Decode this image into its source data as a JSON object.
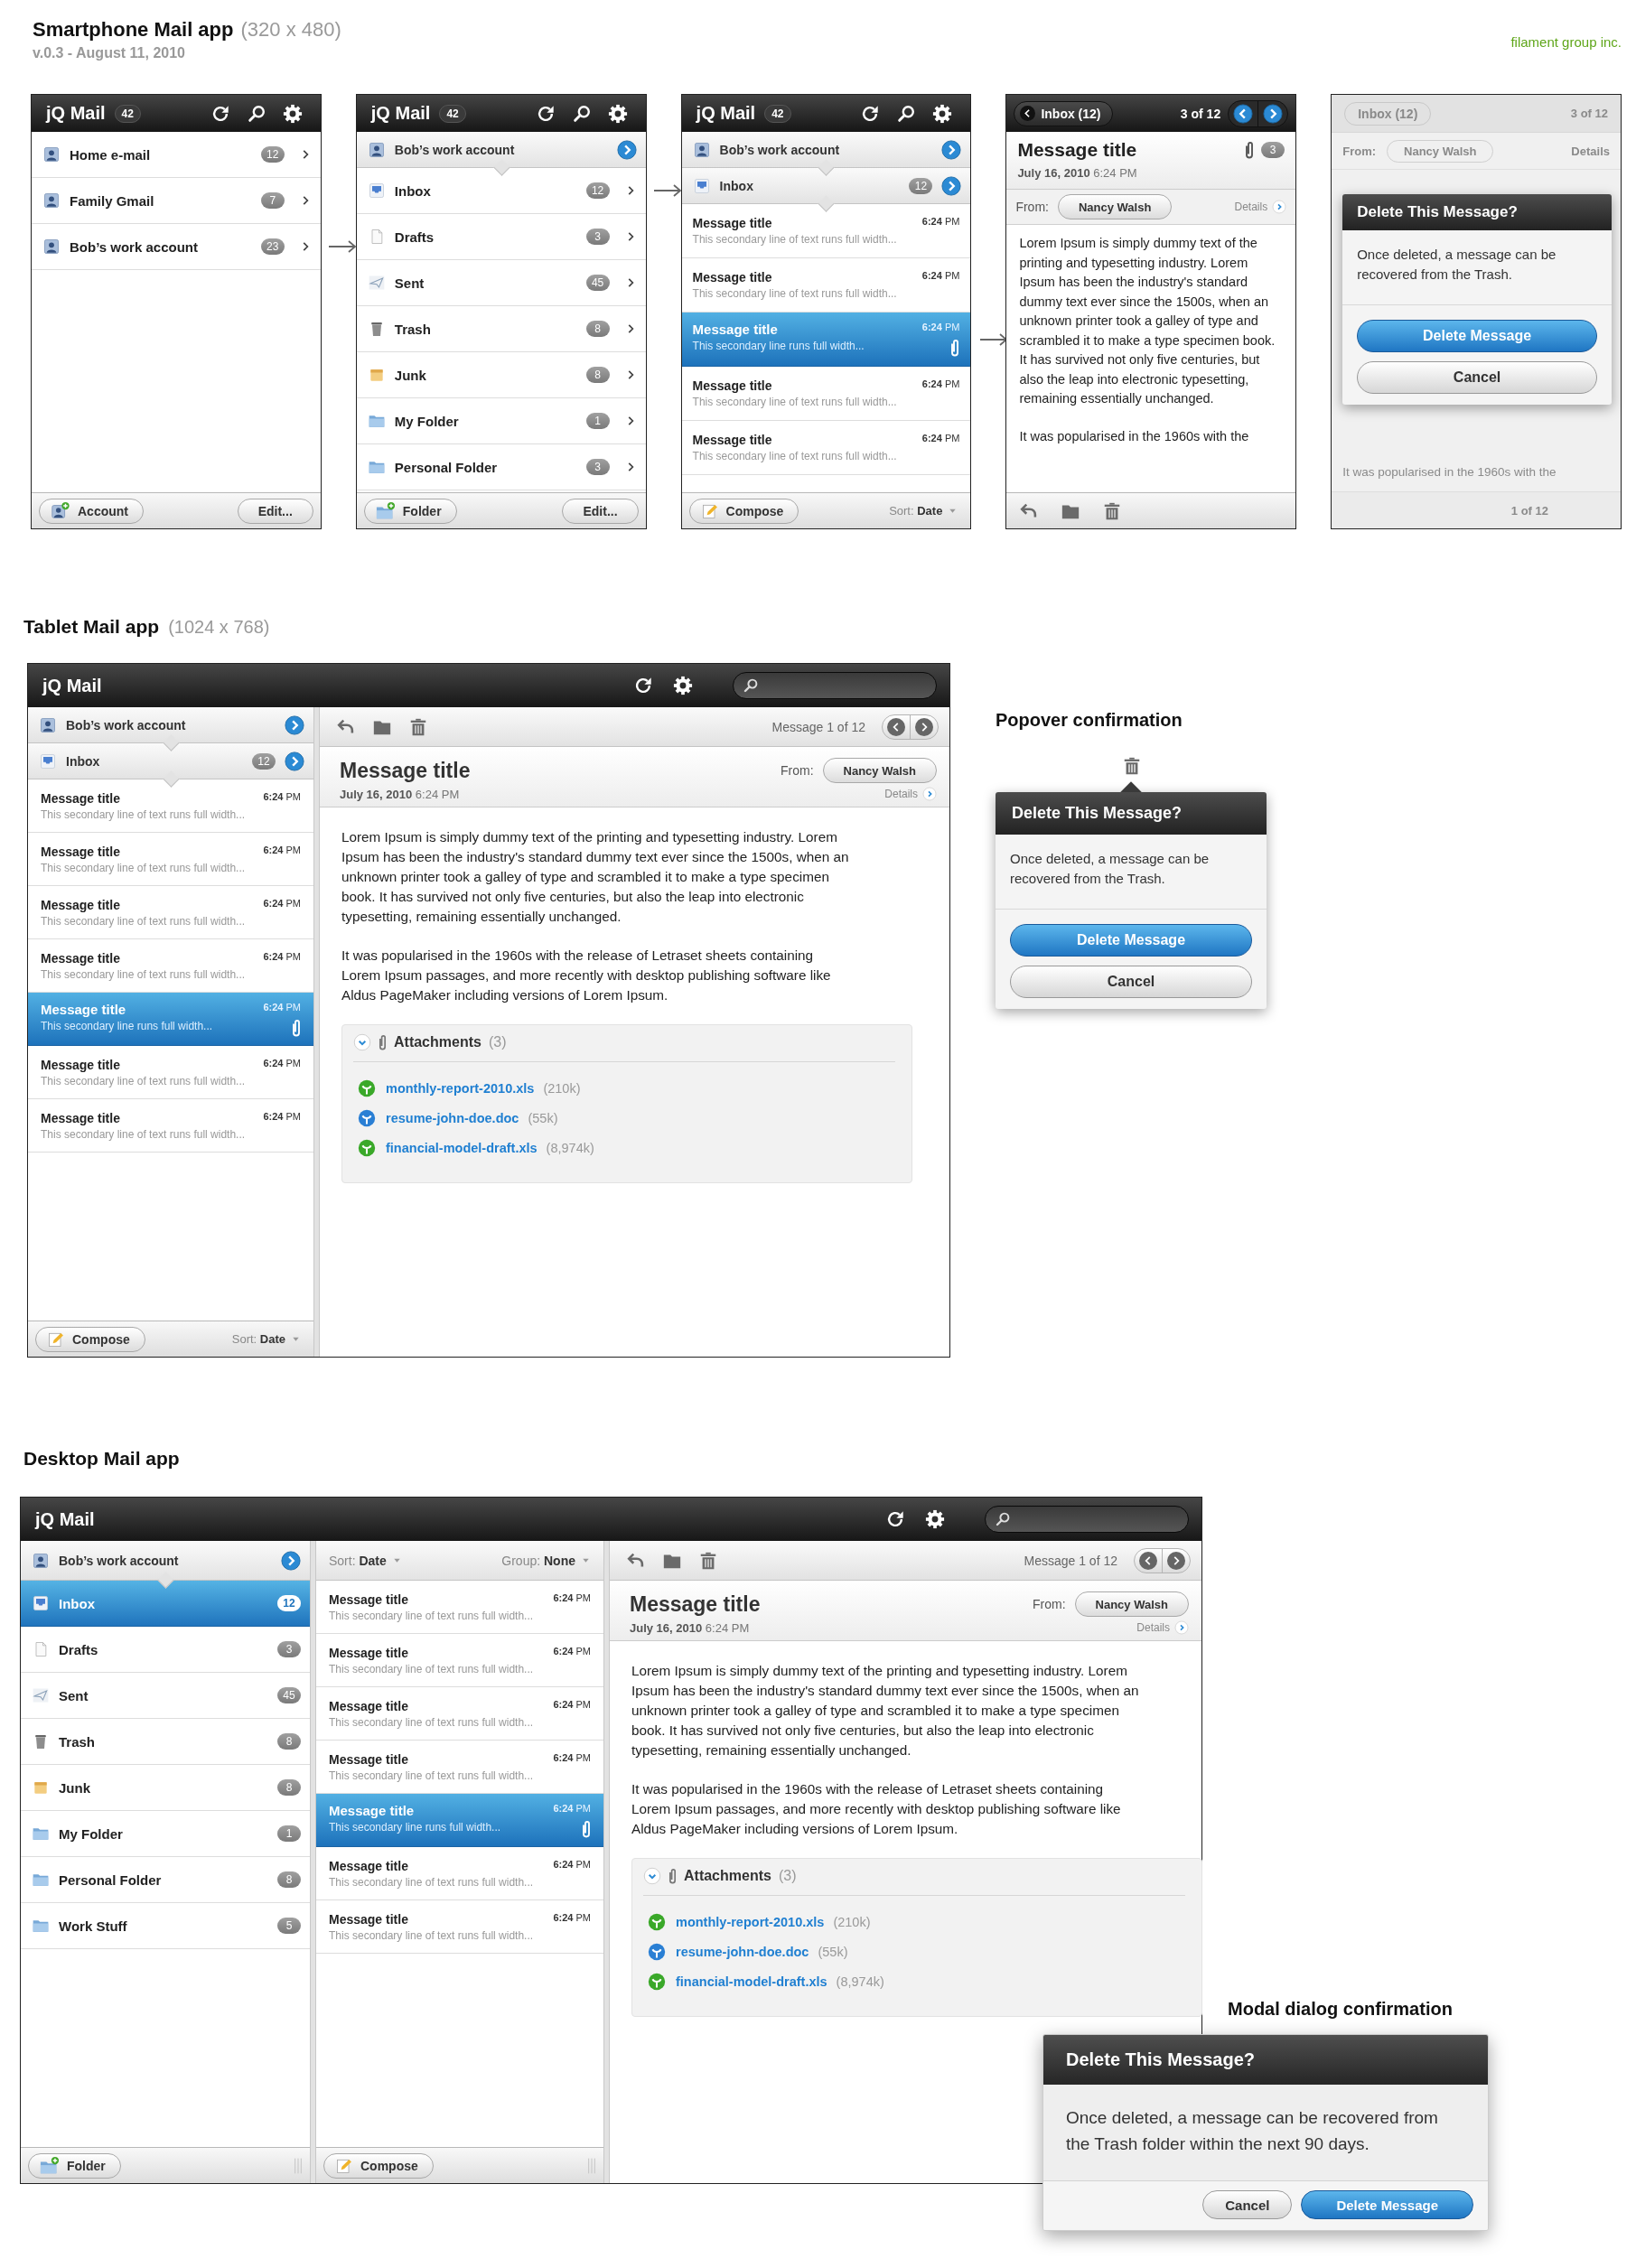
{
  "header": {
    "title": "Smartphone Mail app",
    "size": "(320 x 480)",
    "version": "v.0.3 - August 11, 2010",
    "company": "filament group inc."
  },
  "phones": [
    {
      "kind": "accounts",
      "toolbar": {
        "title": "jQ Mail",
        "count": "42"
      },
      "items": [
        {
          "kind": "account",
          "label": "Home e-mail",
          "count": "12",
          "selected": false,
          "leads_next": false
        },
        {
          "kind": "account",
          "label": "Family Gmail",
          "count": "7",
          "selected": false,
          "leads_next": false
        },
        {
          "kind": "account",
          "label": "Bob’s work account",
          "count": "23",
          "selected": false,
          "leads_next": true
        }
      ],
      "footer": {
        "add": {
          "kind": "account",
          "label": "Account"
        },
        "edit": "Edit..."
      }
    },
    {
      "kind": "folders",
      "toolbar": {
        "title": "jQ Mail",
        "count": "42"
      },
      "account": "Bob’s work account",
      "items": [
        {
          "kind": "inbox",
          "label": "Inbox",
          "count": "12",
          "selected": false,
          "leads_next": true
        },
        {
          "kind": "drafts",
          "label": "Drafts",
          "count": "3",
          "selected": false,
          "leads_next": false
        },
        {
          "kind": "sent",
          "label": "Sent",
          "count": "45",
          "selected": false,
          "leads_next": false
        },
        {
          "kind": "trash",
          "label": "Trash",
          "count": "8",
          "selected": false,
          "leads_next": false
        },
        {
          "kind": "junk",
          "label": "Junk",
          "count": "8",
          "selected": false,
          "leads_next": false
        },
        {
          "kind": "folder",
          "label": "My Folder",
          "count": "1",
          "selected": false,
          "leads_next": false
        },
        {
          "kind": "folder",
          "label": "Personal Folder",
          "count": "3",
          "selected": false,
          "leads_next": false
        }
      ],
      "footer": {
        "add": {
          "kind": "folder",
          "label": "Folder"
        },
        "edit": "Edit..."
      }
    },
    {
      "kind": "messages",
      "toolbar": {
        "title": "jQ Mail",
        "count": "42"
      },
      "account": "Bob’s work account",
      "folder": {
        "kind": "inbox",
        "label": "Inbox",
        "count": "12"
      },
      "messages": [
        {
          "title": "Message title",
          "preview": "This secondary line of text runs full width...",
          "time": "**6:24** PM",
          "selected": false,
          "attachment": false,
          "leads_next": false
        },
        {
          "title": "Message title",
          "preview": "This secondary line of text runs full width...",
          "time": "**6:24** PM",
          "selected": false,
          "attachment": false,
          "leads_next": false
        },
        {
          "title": "Message title",
          "preview": "This secondary line runs full width...",
          "time": "**6:24** PM",
          "selected": true,
          "attachment": true,
          "leads_next": true
        },
        {
          "title": "Message title",
          "preview": "This secondary line of text runs full width...",
          "time": "**6:24** PM",
          "selected": false,
          "attachment": false,
          "leads_next": false
        },
        {
          "title": "Message title",
          "preview": "This secondary line of text runs full width...",
          "time": "**6:24** PM",
          "selected": false,
          "attachment": false,
          "leads_next": false
        }
      ],
      "footer": {
        "compose": "Compose",
        "sort": "Sort: **Date**"
      }
    },
    {
      "kind": "message",
      "nav": {
        "back": "Inbox (12)",
        "position": "3 of 12"
      },
      "title": "Message title",
      "attachments": "3",
      "date": "**July 16, 2010** 6:24 PM",
      "from_label": "From:",
      "from": "Nancy Walsh",
      "details": "Details",
      "paragraphs": [
        "Lorem Ipsum is simply dummy text of the printing and typesetting industry. Lorem Ipsum has been the industry's standard dummy text ever since the 1500s, when an unknown printer took a galley of type and scrambled it to make a type specimen book. It has survived not only five centuries, but also the leap into electronic typesetting, remaining essentially unchanged.",
        "It was popularised in the 1960s with the"
      ]
    },
    {
      "kind": "dialog",
      "background": {
        "back": "Inbox (12)",
        "position": "3 of 12",
        "from_label": "From:",
        "from": "Nancy Walsh",
        "details": "Details",
        "text": "It was popularised in the 1960s with the",
        "footer_position": "1 of 12"
      },
      "dialog": {
        "title": "Delete This Message?",
        "text": "Once deleted, a message can be recovered from the Trash.",
        "confirm": "Delete Message",
        "cancel": "Cancel"
      }
    }
  ],
  "tablet": {
    "heading": "Tablet Mail app",
    "size": "(1024 x 768)",
    "title": "jQ Mail",
    "account": "Bob’s work account",
    "folder": {
      "kind": "inbox",
      "label": "Inbox",
      "count": "12"
    },
    "messages": [
      {
        "title": "Message title",
        "preview": "This secondary line of text runs full width...",
        "time": "**6:24** PM",
        "selected": false,
        "attachment": false
      },
      {
        "title": "Message title",
        "preview": "This secondary line of text runs full width...",
        "time": "**6:24** PM",
        "selected": false,
        "attachment": false
      },
      {
        "title": "Message title",
        "preview": "This secondary line of text runs full width...",
        "time": "**6:24** PM",
        "selected": false,
        "attachment": false
      },
      {
        "title": "Message title",
        "preview": "This secondary line of text runs full width...",
        "time": "**6:24** PM",
        "selected": false,
        "attachment": false
      },
      {
        "title": "Message title",
        "preview": "This secondary line runs full width...",
        "time": "**6:24** PM",
        "selected": true,
        "attachment": true
      },
      {
        "title": "Message title",
        "preview": "This secondary line of text runs full width...",
        "time": "**6:24** PM",
        "selected": false,
        "attachment": false
      },
      {
        "title": "Message title",
        "preview": "This secondary line of text runs full width...",
        "time": "**6:24** PM",
        "selected": false,
        "attachment": false
      }
    ],
    "footer": {
      "compose": "Compose",
      "sort": "Sort: **Date**"
    },
    "reader": {
      "position": "Message 1 of 12",
      "title": "Message title",
      "from_label": "From:",
      "from": "Nancy Walsh",
      "date": "**July 16, 2010** 6:24 PM",
      "details": "Details",
      "paragraphs": [
        "Lorem Ipsum is simply dummy text of the printing and typesetting industry. Lorem Ipsum has been the industry's standard dummy text ever since the 1500s, when an unknown printer took a galley of type and scrambled it to make a type specimen book. It has survived not only five centuries, but also the leap into electronic typesetting, remaining essentially unchanged.",
        "It was popularised in the 1960s with the release of Letraset sheets containing Lorem Ipsum passages, and more recently with desktop publishing software like Aldus PageMaker including versions of Lorem Ipsum."
      ],
      "attachments": {
        "label": "Attachments",
        "count": "(3)",
        "files": [
          {
            "kind": "spreadsheet",
            "name": "monthly-report-2010.xls",
            "size": "(210k)"
          },
          {
            "kind": "document",
            "name": "resume-john-doe.doc",
            "size": "(55k)"
          },
          {
            "kind": "spreadsheet",
            "name": "financial-model-draft.xls",
            "size": "(8,974k)"
          }
        ]
      }
    }
  },
  "popover": {
    "heading": "Popover confirmation",
    "title": "Delete This Message?",
    "text": "Once deleted, a message can be recovered from the Trash.",
    "confirm": "Delete Message",
    "cancel": "Cancel"
  },
  "desktop": {
    "heading": "Desktop Mail app",
    "title": "jQ Mail",
    "account": "Bob’s work account",
    "folders": [
      {
        "kind": "inbox",
        "label": "Inbox",
        "count": "12",
        "selected": true
      },
      {
        "kind": "drafts",
        "label": "Drafts",
        "count": "3",
        "selected": false
      },
      {
        "kind": "sent",
        "label": "Sent",
        "count": "45",
        "selected": false
      },
      {
        "kind": "trash",
        "label": "Trash",
        "count": "8",
        "selected": false
      },
      {
        "kind": "junk",
        "label": "Junk",
        "count": "8",
        "selected": false
      },
      {
        "kind": "folder",
        "label": "My Folder",
        "count": "1",
        "selected": false
      },
      {
        "kind": "folder",
        "label": "Personal Folder",
        "count": "8",
        "selected": false
      },
      {
        "kind": "folder",
        "label": "Work Stuff",
        "count": "5",
        "selected": false
      }
    ],
    "folder_button": {
      "kind": "folder",
      "label": "Folder"
    },
    "sort": "Sort: **Date**",
    "group": "Group: **None**",
    "messages": [
      {
        "title": "Message title",
        "preview": "This secondary line of text runs full width...",
        "time": "**6:24** PM",
        "selected": false,
        "attachment": false
      },
      {
        "title": "Message title",
        "preview": "This secondary line of text runs full width...",
        "time": "**6:24** PM",
        "selected": false,
        "attachment": false
      },
      {
        "title": "Message title",
        "preview": "This secondary line of text runs full width...",
        "time": "**6:24** PM",
        "selected": false,
        "attachment": false
      },
      {
        "title": "Message title",
        "preview": "This secondary line of text runs full width...",
        "time": "**6:24** PM",
        "selected": false,
        "attachment": false
      },
      {
        "title": "Message title",
        "preview": "This secondary line runs full width...",
        "time": "**6:24** PM",
        "selected": true,
        "attachment": true
      },
      {
        "title": "Message title",
        "preview": "This secondary line of text runs full width...",
        "time": "**6:24** PM",
        "selected": false,
        "attachment": false
      },
      {
        "title": "Message title",
        "preview": "This secondary line of text runs full width...",
        "time": "**6:24** PM",
        "selected": false,
        "attachment": false
      }
    ],
    "compose": "Compose",
    "reader": {
      "position": "Message 1 of 12",
      "title": "Message title",
      "from_label": "From:",
      "from": "Nancy Walsh",
      "date": "**July 16, 2010** 6:24 PM",
      "details": "Details",
      "paragraphs": [
        "Lorem Ipsum is simply dummy text of the printing and typesetting industry. Lorem Ipsum has been the industry's standard dummy text ever since the 1500s, when an unknown printer took a galley of type and scrambled it to make a type specimen book. It has survived not only five centuries, but also the leap into electronic typesetting, remaining essentially unchanged.",
        "It was popularised in the 1960s with the release of Letraset sheets containing Lorem Ipsum passages, and more recently with desktop publishing software like Aldus PageMaker including versions of Lorem Ipsum."
      ],
      "attachments": {
        "label": "Attachments",
        "count": "(3)",
        "files": [
          {
            "kind": "spreadsheet",
            "name": "monthly-report-2010.xls",
            "size": "(210k)"
          },
          {
            "kind": "document",
            "name": "resume-john-doe.doc",
            "size": "(55k)"
          },
          {
            "kind": "spreadsheet",
            "name": "financial-model-draft.xls",
            "size": "(8,974k)"
          }
        ]
      }
    }
  },
  "modal": {
    "heading": "Modal dialog confirmation",
    "title": "Delete This Message?",
    "text": "Once deleted, a message can be recovered from the Trash folder within the next 90 days.",
    "cancel": "Cancel",
    "confirm": "Delete Message"
  }
}
